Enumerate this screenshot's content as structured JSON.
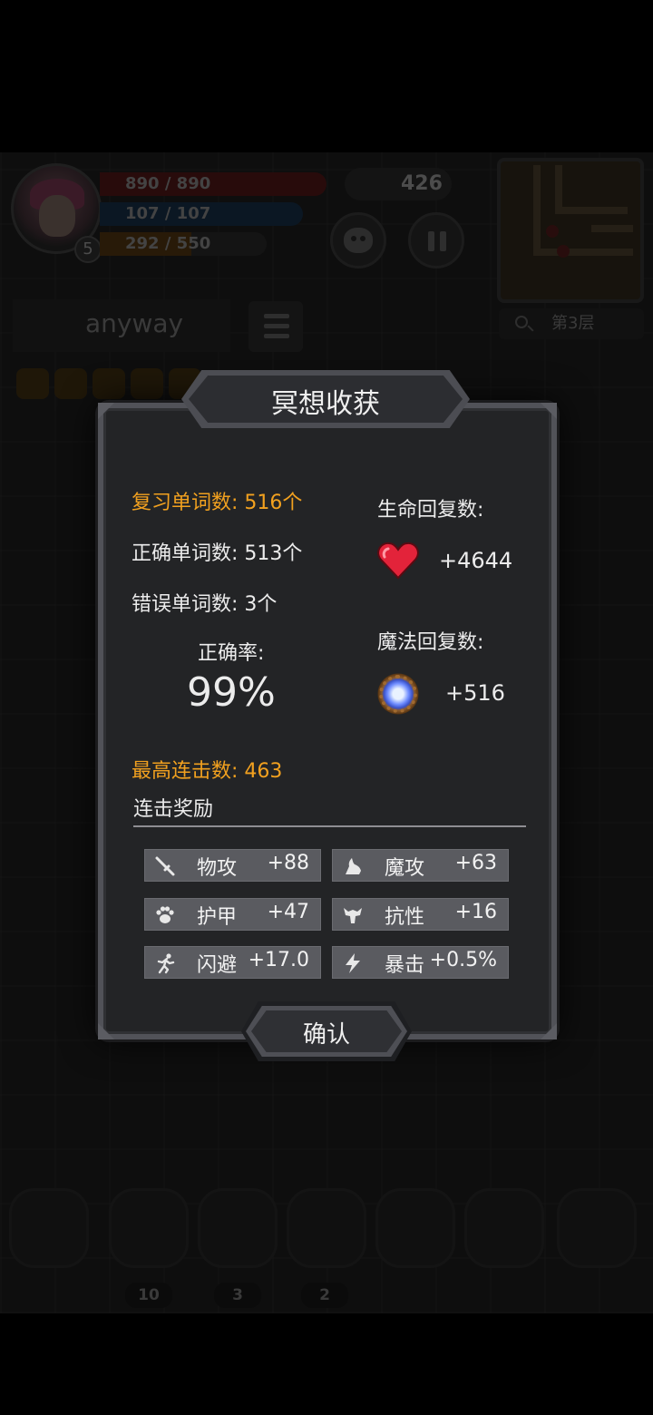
{
  "hud": {
    "hp_text": "890 / 890",
    "mp_text": "107 / 107",
    "xp_text": "292 / 550",
    "level": "5",
    "gold": "426",
    "floor_label": "第3层",
    "current_word": "anyway"
  },
  "items": [
    {
      "count": "10"
    },
    {
      "count": "3"
    },
    {
      "count": "2"
    }
  ],
  "dialog": {
    "title": "冥想收获",
    "review_count": "复习单词数: 516个",
    "correct_count": "正确单词数: 513个",
    "wrong_count": "错误单词数: 3个",
    "accuracy_label": "正确率:",
    "accuracy_value": "99%",
    "hp_recover_label": "生命回复数:",
    "hp_recover_value": "+4644",
    "mp_recover_label": "魔法回复数:",
    "mp_recover_value": "+516",
    "max_combo": "最高连击数: 463",
    "combo_reward_title": "连击奖励",
    "stats": [
      {
        "icon": "sword-icon",
        "label": "物攻",
        "value": "+88"
      },
      {
        "icon": "magic-hand-icon",
        "label": "魔攻",
        "value": "+63"
      },
      {
        "icon": "paw-icon",
        "label": "护甲",
        "value": "+47"
      },
      {
        "icon": "muscle-icon",
        "label": "抗性",
        "value": "+16"
      },
      {
        "icon": "running-icon",
        "label": "闪避",
        "value": "+17.0"
      },
      {
        "icon": "lightning-icon",
        "label": "暴击",
        "value": "+0.5%"
      }
    ],
    "confirm_label": "确认"
  },
  "colors": {
    "highlight": "#f2a11f",
    "panel": "#232426",
    "stat_bg": "#5a5b60",
    "heart": "#e3233a"
  }
}
